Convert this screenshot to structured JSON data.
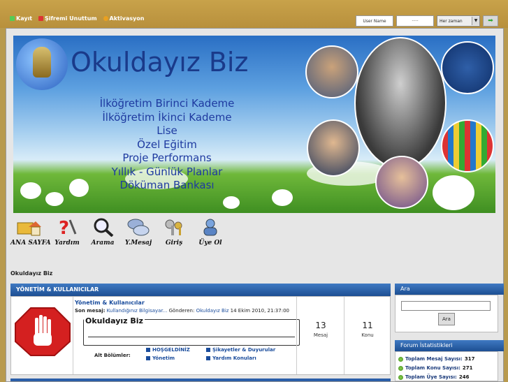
{
  "toplinks": {
    "register": "Kayıt",
    "forgot": "Şifremi Unuttum",
    "activation": "Aktivasyon"
  },
  "login": {
    "username": "User Name",
    "password": "·····",
    "duration": "Her zaman"
  },
  "banner": {
    "title": "Okuldayız Biz",
    "lines": [
      "İlköğretim Birinci Kademe",
      "İlköğretim İkinci Kademe",
      "Lise",
      "Özel Eğitim",
      "Proje Performans",
      "Yıllık - Günlük Planlar",
      "Döküman Bankası"
    ]
  },
  "nav": {
    "home": "ANA SAYFA",
    "help": "Yardım",
    "search": "Arama",
    "newmsg": "Y.Mesaj",
    "login": "Giriş",
    "register": "Üye Ol"
  },
  "breadcrumb": "Okuldayız Biz",
  "category": {
    "title": "YÖNETİM & KULLANICILAR",
    "forum": {
      "name": "Yönetim & Kullanıcılar",
      "lastmsg_label": "Son mesaj:",
      "lastmsg_link": "Kullandığınız Bilgisayar...",
      "sent_label": "Gönderen:",
      "sender": "Okuldayız Biz",
      "date": "14 Ekim 2010, 21:37:00",
      "subbox_title": "Okuldayız Biz",
      "sub_label": "Alt Bölümler:",
      "subforums": [
        "HOŞGELDİNİZ",
        "Şikayetler & Duyurular",
        "Yönetim",
        "Yardım Konuları"
      ],
      "messages": "13",
      "messages_label": "Mesaj",
      "topics": "11",
      "topics_label": "Konu"
    }
  },
  "sidebar": {
    "search_title": "Ara",
    "search_button": "Ara",
    "stats_title": "Forum İstatistikleri",
    "stats": [
      {
        "label": "Toplam Mesaj Sayısı:",
        "value": "317"
      },
      {
        "label": "Toplam Konu Sayısı:",
        "value": "271"
      },
      {
        "label": "Toplam Üye Sayısı:",
        "value": "246"
      }
    ]
  }
}
